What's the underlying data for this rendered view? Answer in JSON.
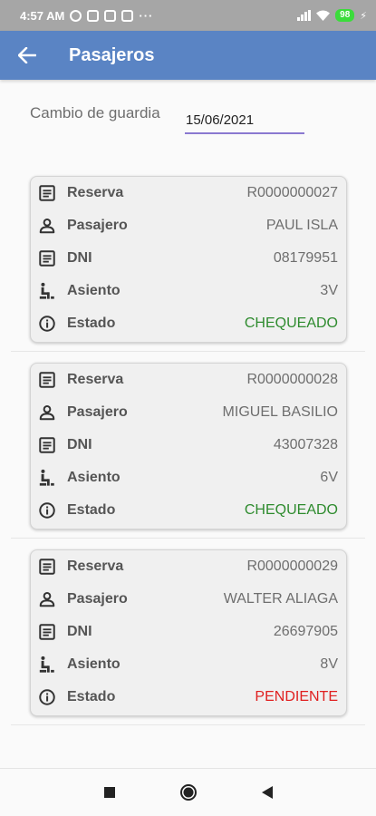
{
  "status_bar": {
    "time": "4:57 AM",
    "dots": "···",
    "battery": "98"
  },
  "app_bar": {
    "title": "Pasajeros"
  },
  "guard": {
    "label": "Cambio de guardia",
    "date": "15/06/2021"
  },
  "field_labels": {
    "reserva": "Reserva",
    "pasajero": "Pasajero",
    "dni": "DNI",
    "asiento": "Asiento",
    "estado": "Estado"
  },
  "passengers": [
    {
      "reserva": "R0000000027",
      "pasajero": "PAUL ISLA",
      "dni": "08179951",
      "asiento": "3V",
      "estado": "CHEQUEADO"
    },
    {
      "reserva": "R0000000028",
      "pasajero": "MIGUEL BASILIO",
      "dni": "43007328",
      "asiento": "6V",
      "estado": "CHEQUEADO"
    },
    {
      "reserva": "R0000000029",
      "pasajero": "WALTER ALIAGA",
      "dni": "26697905",
      "asiento": "8V",
      "estado": "PENDIENTE"
    }
  ],
  "colors": {
    "app_bar": "#5a84c4",
    "checked": "#2e8b2e",
    "pending": "#e02020",
    "date_underline": "#8a78d0"
  }
}
